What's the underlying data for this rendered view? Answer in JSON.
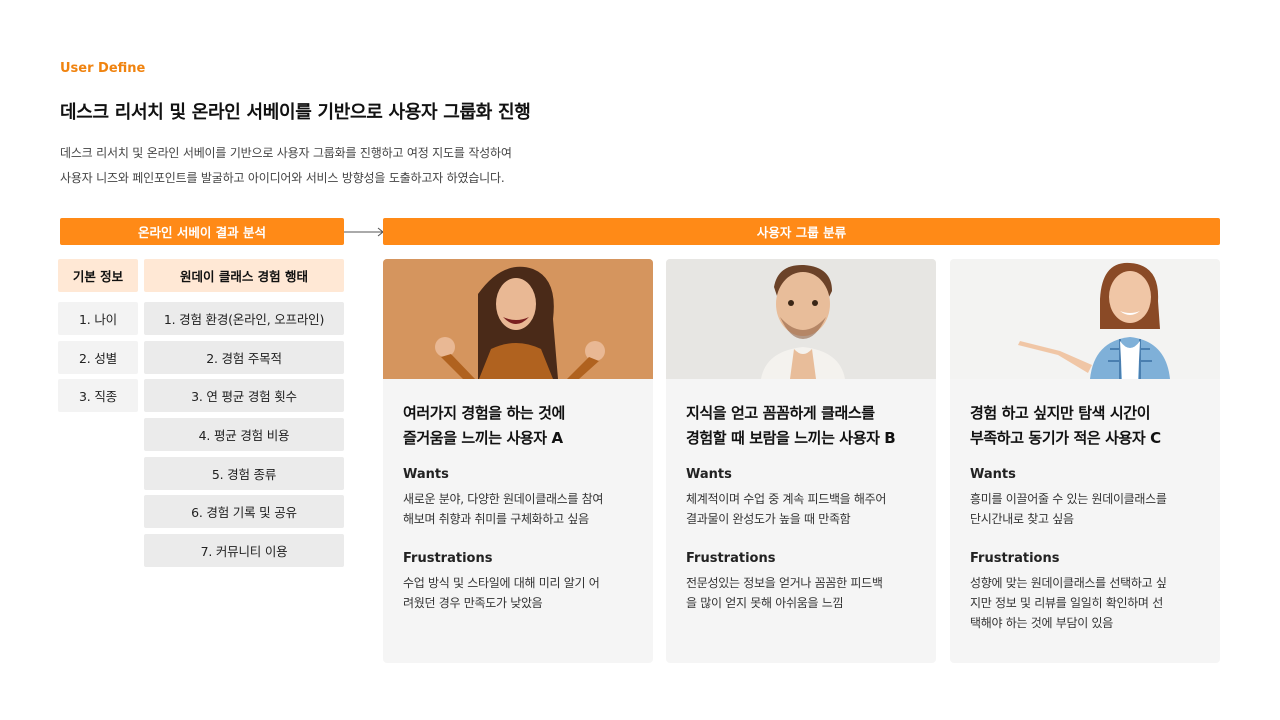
{
  "section_tag": "User Define",
  "headline": "데스크 리서치 및 온라인 서베이를 기반으로 사용자 그룹화 진행",
  "description": {
    "line1": "데스크 리서치 및 온라인 서베이를 기반으로 사용자 그룹화를 진행하고 여정 지도를 작성하여",
    "line2": "사용자 니즈와 페인포인트를 발굴하고 아이디어와 서비스 방향성을 도출하고자 하였습니다."
  },
  "analysis_bar": "온라인 서베이 결과 분석",
  "group_bar": "사용자 그룹 분류",
  "basic_info": {
    "header": "기본 정보",
    "items": [
      "1. 나이",
      "2. 성별",
      "3. 직종"
    ]
  },
  "class_experience": {
    "header": "원데이 클래스 경험 행태",
    "items": [
      "1. 경험 환경(온라인, 오프라인)",
      "2. 경험 주목적",
      "3. 연 평균 경험 횟수",
      "4. 평균 경험 비용",
      "5. 경험 종류",
      "6. 경험 기록 및 공유",
      "7. 커뮤니티 이용"
    ]
  },
  "cards": [
    {
      "title_line1": "여러가지 경험을 하는 것에",
      "title_line2": "즐거움을 느끼는 사용자 A",
      "wants_label": "Wants",
      "wants_line1": "새로운 분야, 다양한 원데이클래스를 참여",
      "wants_line2": "해보며 취향과 취미를 구체화하고 싶음",
      "frustrations_label": "Frustrations",
      "frustrations_line1": "수업 방식 및 스타일에 대해 미리 알기 어",
      "frustrations_line2": "려웠던 경우 만족도가 낮았음",
      "frustrations_line3": ""
    },
    {
      "title_line1": "지식을 얻고 꼼꼼하게 클래스를",
      "title_line2": "경험할 때 보람을 느끼는 사용자 B",
      "wants_label": "Wants",
      "wants_line1": "체계적이며 수업 중 계속 피드백을 해주어",
      "wants_line2": "결과물이 완성도가 높을 때 만족함",
      "frustrations_label": "Frustrations",
      "frustrations_line1": "전문성있는 정보을 얻거나 꼼꼼한 피드백",
      "frustrations_line2": "을 많이 얻지 못해 아쉬움을 느낌",
      "frustrations_line3": ""
    },
    {
      "title_line1": "경험 하고 싶지만 탐색 시간이",
      "title_line2": "부족하고 동기가 적은 사용자 C",
      "wants_label": "Wants",
      "wants_line1": "흥미를 이끌어줄 수 있는 원데이클래스를",
      "wants_line2": "단시간내로 찾고 싶음",
      "frustrations_label": "Frustrations",
      "frustrations_line1": "성향에 맞는 원데이클래스를 선택하고 싶",
      "frustrations_line2": "지만 정보 및 리뷰를 일일히 확인하며 선",
      "frustrations_line3": "택해야 하는 것에 부담이 있음"
    }
  ],
  "colors": {
    "accent": "#ff8a17",
    "accent_light": "#ffe8d5",
    "card_bg": "#f5f5f5"
  }
}
